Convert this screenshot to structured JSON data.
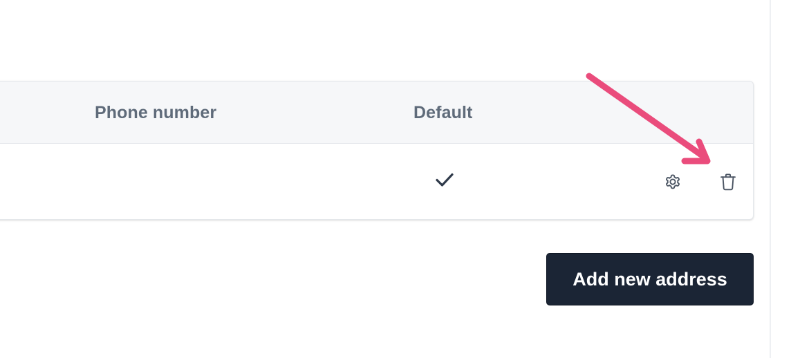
{
  "table": {
    "headers": {
      "phone": "Phone number",
      "default": "Default"
    },
    "rows": [
      {
        "is_default": true,
        "actions": [
          "gear-icon",
          "trash-icon"
        ]
      }
    ]
  },
  "actions": {
    "add_address_label": "Add new address"
  },
  "icons": {
    "default_indicator": "checkmark-icon",
    "settings": "gear-icon",
    "delete": "trash-icon"
  },
  "colors": {
    "header_background": "#f6f7f9",
    "header_text": "#5f6b7a",
    "icon_color": "#4b5563",
    "button_background": "#1b2535",
    "button_text": "#ffffff",
    "annotation_arrow": "#ea4c7c"
  }
}
